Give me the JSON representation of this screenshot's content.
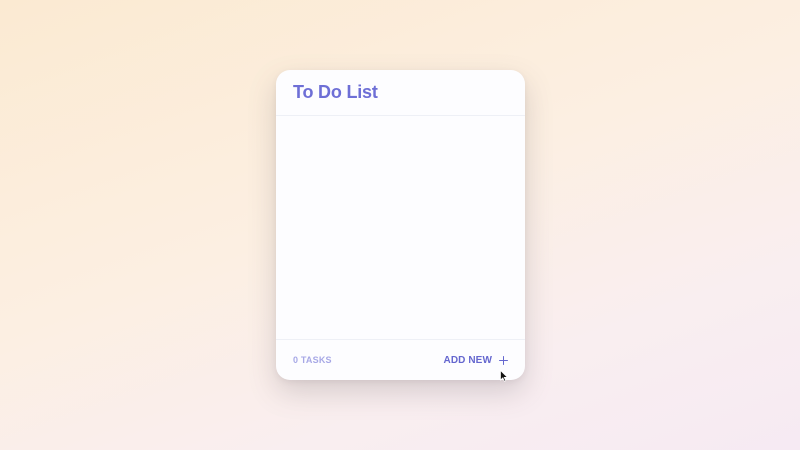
{
  "card": {
    "title": "To Do List",
    "task_count_label": "0 TASKS",
    "add_new_label": "ADD NEW"
  },
  "icons": {
    "add": "plus-icon",
    "pointer": "mouse-cursor-icon"
  },
  "colors": {
    "accent": "#6e6fd6",
    "muted_accent": "#a7a8e6",
    "card_background": "#fdfdff"
  }
}
